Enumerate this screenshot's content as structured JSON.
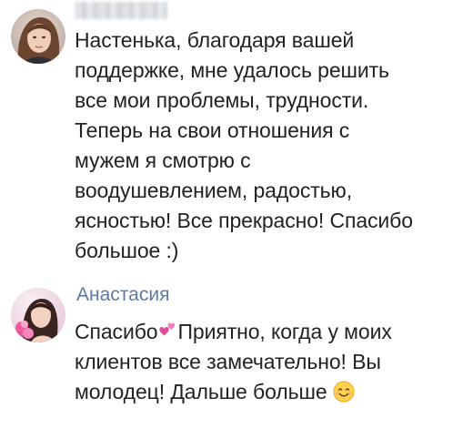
{
  "messages": [
    {
      "author": "",
      "avatar_icon": "user-avatar-woman-icon",
      "lines": [
        "Настенька, благодаря вашей",
        "поддержке, мне удалось решить",
        "все мои проблемы, трудности.",
        "Теперь на свои отношения с",
        "мужем я смотрю с",
        "воодушевлением, радостью,",
        "ясностью! Все прекрасно! Спасибо",
        "большое :)"
      ]
    },
    {
      "author": "Анастасия",
      "avatar_icon": "user-avatar-anastasia-icon",
      "line1_part1": "Спасибо",
      "line1_emoji": "pink-hearts-icon",
      "line1_part2": "Приятно, когда у моих",
      "line2": "клиентов все замечательно! Вы",
      "line3": "молодец! Дальше больше",
      "line3_emoji": "smiling-face-icon"
    }
  ],
  "colors": {
    "author_name": "#5b7aa3",
    "text": "#222222",
    "background": "#ffffff"
  }
}
